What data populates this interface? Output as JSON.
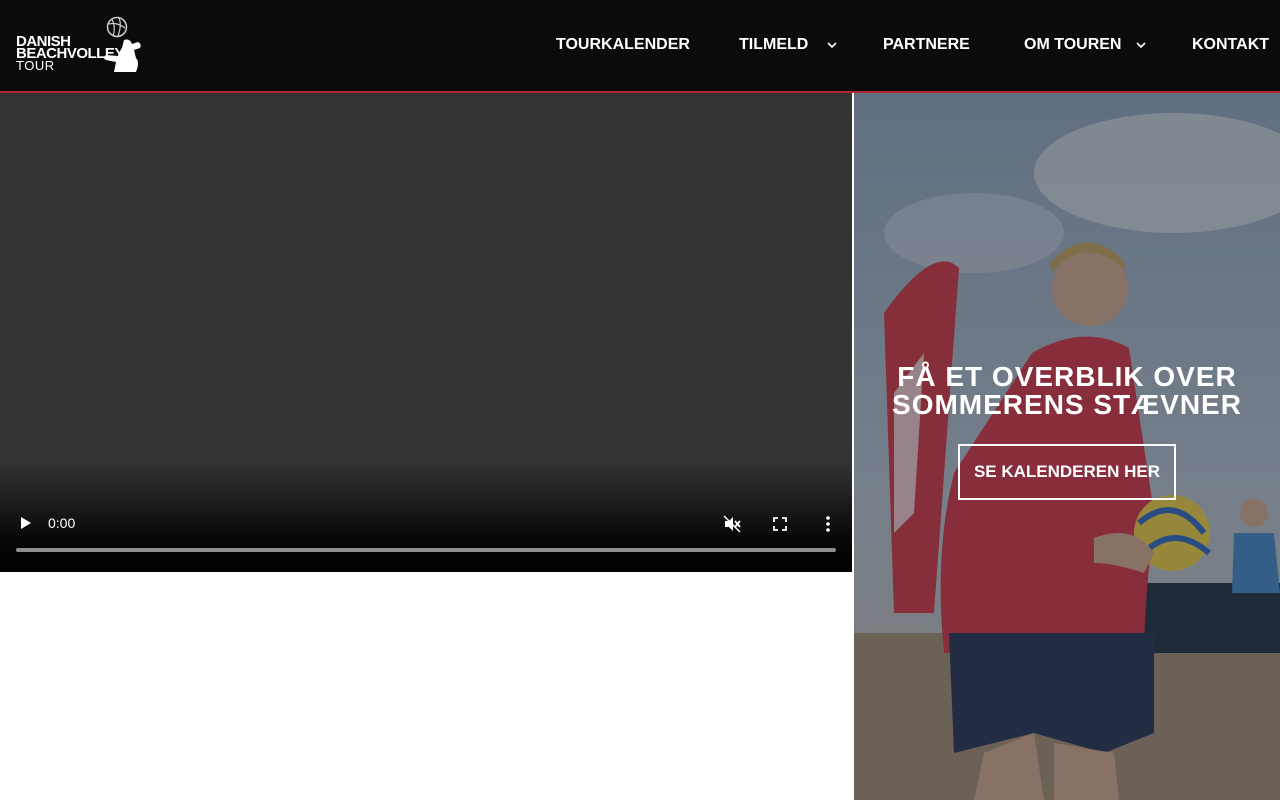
{
  "brand": {
    "logo_line1": "DANISH",
    "logo_line2": "BEACHVOLLEY",
    "logo_line3": "TOUR"
  },
  "nav": {
    "items": [
      {
        "label": "TOURKALENDER",
        "has_submenu": false
      },
      {
        "label": "TILMELD",
        "has_submenu": true
      },
      {
        "label": "PARTNERE",
        "has_submenu": false
      },
      {
        "label": "OM TOUREN",
        "has_submenu": true
      },
      {
        "label": "KONTAKT",
        "has_submenu": false
      }
    ]
  },
  "video": {
    "current_time": "0:00",
    "progress_fraction": 0,
    "controls": [
      "play-icon",
      "mute-icon",
      "fullscreen-icon",
      "more-options-icon"
    ]
  },
  "hero": {
    "title_line1": "FÅ ET OVERBLIK OVER",
    "title_line2": "SOMMERENS STÆVNER",
    "cta_label": "SE KALENDEREN HER"
  },
  "colors": {
    "header_bg": "#0b0b0c",
    "accent_line": "#b3262b",
    "video_bg": "#333333"
  }
}
